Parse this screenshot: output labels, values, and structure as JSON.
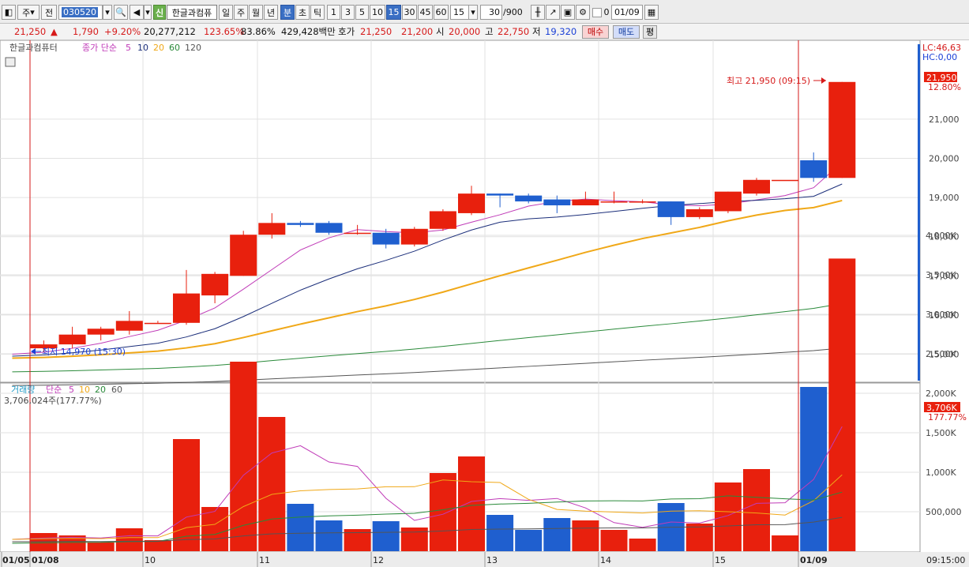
{
  "toolbar": {
    "type_label": "주",
    "prev_label": "전",
    "code": "030520",
    "sin_badge": "신",
    "stock_name": "한글과컴퓨",
    "periods": [
      "일",
      "주",
      "월",
      "년",
      "분",
      "초",
      "틱",
      "1",
      "3",
      "5",
      "10",
      "15",
      "30",
      "45",
      "60"
    ],
    "active_periods": [
      "분",
      "15"
    ],
    "interval_value": "15",
    "count_value": "30",
    "count_total": "/900",
    "checkbox_label": "0",
    "date_value": "01/09"
  },
  "quote": {
    "price": "21,250",
    "change_arrow": "▲",
    "change": "1,790",
    "change_pct": "+9.20%",
    "volume": "20,277,212",
    "volume_ratio": "123.65%",
    "turnover_ratio": "83.86%",
    "trade_value": "429,428백만",
    "hoga_label": "호가",
    "ask": "21,250",
    "bid": "21,200",
    "open_label": "시",
    "open": "20,000",
    "high_label": "고",
    "high": "22,750",
    "low_label": "저",
    "low": "19,320",
    "buy_button": "매수",
    "sell_button": "매도",
    "eval_button": "평"
  },
  "price_legend": {
    "name": "한글과컴퓨터",
    "ma_label": "종가 단순",
    "ma_periods": [
      "5",
      "10",
      "20",
      "60",
      "120"
    ]
  },
  "volume_legend": {
    "name": "거래량",
    "ma_label": "단순",
    "ma_periods": [
      "5",
      "10",
      "20",
      "60",
      "120"
    ],
    "current": "3,706,024주(177.77%)"
  },
  "price_axis": {
    "lc": "LC:46,63",
    "hc": "HC:0,00",
    "ticks": [
      "21,000",
      "20,000",
      "19,000",
      "18,000",
      "17,000",
      "16,000",
      "15,000"
    ],
    "current_tag": "21,950",
    "current_pct": "12.80%"
  },
  "volume_axis": {
    "ticks": [
      "4,000K",
      "3,500K",
      "3,000K",
      "2,500K",
      "2,000K",
      "1,500K",
      "1,000K",
      "500,000"
    ],
    "current_tag": "3,706K",
    "current_pct": "177.77%"
  },
  "annotations": {
    "high": "최고 21,950 (09:15)",
    "low": "최저 14,970 (15:30)"
  },
  "date_axis": {
    "labels": [
      "01/05",
      "01/08",
      "10",
      "11",
      "12",
      "13",
      "14",
      "15",
      "01/09"
    ],
    "time": "09:15:00"
  },
  "colors": {
    "up": "#e8200d",
    "down": "#1f5fcf",
    "ma5": "#c03cb8",
    "ma10": "#1b2e7a",
    "ma20": "#f0a818",
    "ma60": "#2a8a3a",
    "ma120": "#555555",
    "marker": "#d61a1a"
  },
  "chart_data": {
    "type": "candlestick",
    "price_candles": [
      {
        "o": 15150,
        "h": 15350,
        "l": 15050,
        "c": 15250
      },
      {
        "o": 15250,
        "h": 15700,
        "l": 15150,
        "c": 15500
      },
      {
        "o": 15500,
        "h": 15700,
        "l": 15350,
        "c": 15650
      },
      {
        "o": 15600,
        "h": 16100,
        "l": 15500,
        "c": 15850
      },
      {
        "o": 15800,
        "h": 15850,
        "l": 15800,
        "c": 15800
      },
      {
        "o": 15800,
        "h": 17150,
        "l": 15750,
        "c": 16550
      },
      {
        "o": 16500,
        "h": 17100,
        "l": 16300,
        "c": 17050
      },
      {
        "o": 17000,
        "h": 18150,
        "l": 17000,
        "c": 18050
      },
      {
        "o": 18050,
        "h": 18600,
        "l": 17950,
        "c": 18350
      },
      {
        "o": 18350,
        "h": 18400,
        "l": 18250,
        "c": 18300
      },
      {
        "o": 18350,
        "h": 18400,
        "l": 18050,
        "c": 18100
      },
      {
        "o": 18100,
        "h": 18300,
        "l": 18050,
        "c": 18100
      },
      {
        "o": 18100,
        "h": 18200,
        "l": 17700,
        "c": 17800
      },
      {
        "o": 17800,
        "h": 18250,
        "l": 17750,
        "c": 18200
      },
      {
        "o": 18200,
        "h": 18700,
        "l": 18150,
        "c": 18650
      },
      {
        "o": 18600,
        "h": 19300,
        "l": 18550,
        "c": 19100
      },
      {
        "o": 19100,
        "h": 19100,
        "l": 18750,
        "c": 19050
      },
      {
        "o": 19050,
        "h": 19100,
        "l": 18850,
        "c": 18900
      },
      {
        "o": 18950,
        "h": 19050,
        "l": 18600,
        "c": 18800
      },
      {
        "o": 18800,
        "h": 19150,
        "l": 18800,
        "c": 18950
      },
      {
        "o": 18900,
        "h": 19150,
        "l": 18850,
        "c": 18900
      },
      {
        "o": 18900,
        "h": 18950,
        "l": 18850,
        "c": 18900
      },
      {
        "o": 18900,
        "h": 18900,
        "l": 18300,
        "c": 18500
      },
      {
        "o": 18500,
        "h": 18750,
        "l": 18450,
        "c": 18700
      },
      {
        "o": 18650,
        "h": 19150,
        "l": 18600,
        "c": 19150
      },
      {
        "o": 19100,
        "h": 19500,
        "l": 19050,
        "c": 19450
      },
      {
        "o": 19450,
        "h": 19450,
        "l": 19450,
        "c": 19450
      },
      {
        "o": 19950,
        "h": 20150,
        "l": 19400,
        "c": 19500
      },
      {
        "o": 19500,
        "h": 21950,
        "l": 19500,
        "c": 21950
      }
    ],
    "volumes": [
      230,
      200,
      110,
      290,
      140,
      1420,
      560,
      2400,
      1700,
      600,
      390,
      280,
      380,
      300,
      990,
      1200,
      460,
      270,
      420,
      390,
      270,
      160,
      610,
      350,
      870,
      1040,
      200,
      2080,
      3706
    ],
    "volume_unit": "K",
    "ylim_price": [
      14500,
      22500
    ],
    "ylim_volume": [
      0,
      4200
    ]
  }
}
